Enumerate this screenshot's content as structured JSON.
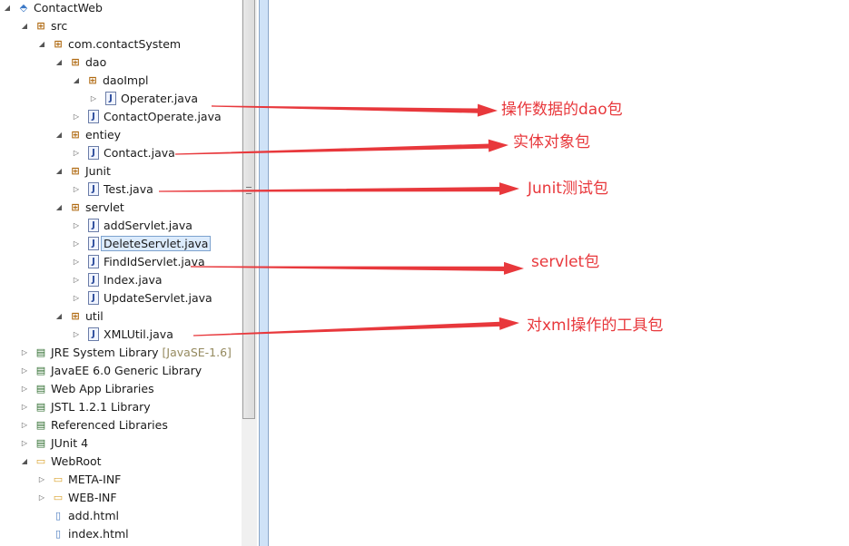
{
  "tree": [
    {
      "label": "ContactWeb",
      "level": 0,
      "twisty": "expanded",
      "icon": "project-icon"
    },
    {
      "label": "src",
      "level": 1,
      "twisty": "expanded",
      "icon": "source-folder-icon"
    },
    {
      "label": "com.contactSystem",
      "level": 2,
      "twisty": "expanded",
      "icon": "package-icon"
    },
    {
      "label": "dao",
      "level": 3,
      "twisty": "expanded",
      "icon": "package-icon"
    },
    {
      "label": "daoImpl",
      "level": 4,
      "twisty": "expanded",
      "icon": "package-icon"
    },
    {
      "label": "Operater.java",
      "level": 5,
      "twisty": "collapsed",
      "icon": "java-file-icon"
    },
    {
      "label": "ContactOperate.java",
      "level": 4,
      "twisty": "collapsed",
      "icon": "java-file-icon"
    },
    {
      "label": "entiey",
      "level": 3,
      "twisty": "expanded",
      "icon": "package-icon"
    },
    {
      "label": "Contact.java",
      "level": 4,
      "twisty": "collapsed",
      "icon": "java-file-icon"
    },
    {
      "label": "Junit",
      "level": 3,
      "twisty": "expanded",
      "icon": "package-icon"
    },
    {
      "label": "Test.java",
      "level": 4,
      "twisty": "collapsed",
      "icon": "java-file-icon"
    },
    {
      "label": "servlet",
      "level": 3,
      "twisty": "expanded",
      "icon": "package-icon"
    },
    {
      "label": "addServlet.java",
      "level": 4,
      "twisty": "collapsed",
      "icon": "java-file-icon"
    },
    {
      "label": "DeleteServlet.java",
      "level": 4,
      "twisty": "collapsed",
      "icon": "java-file-icon",
      "selected": true
    },
    {
      "label": "FindIdServlet.java",
      "level": 4,
      "twisty": "collapsed",
      "icon": "java-file-icon"
    },
    {
      "label": "Index.java",
      "level": 4,
      "twisty": "collapsed",
      "icon": "java-file-icon"
    },
    {
      "label": "UpdateServlet.java",
      "level": 4,
      "twisty": "collapsed",
      "icon": "java-file-icon"
    },
    {
      "label": "util",
      "level": 3,
      "twisty": "expanded",
      "icon": "package-icon"
    },
    {
      "label": "XMLUtil.java",
      "level": 4,
      "twisty": "collapsed",
      "icon": "java-file-icon"
    },
    {
      "label": "JRE System Library",
      "level": 1,
      "twisty": "collapsed",
      "icon": "library-icon",
      "decoration": "[JavaSE-1.6]"
    },
    {
      "label": "JavaEE 6.0 Generic Library",
      "level": 1,
      "twisty": "collapsed",
      "icon": "library-icon"
    },
    {
      "label": "Web App Libraries",
      "level": 1,
      "twisty": "collapsed",
      "icon": "library-icon"
    },
    {
      "label": "JSTL 1.2.1 Library",
      "level": 1,
      "twisty": "collapsed",
      "icon": "library-icon"
    },
    {
      "label": "Referenced Libraries",
      "level": 1,
      "twisty": "collapsed",
      "icon": "library-icon"
    },
    {
      "label": "JUnit 4",
      "level": 1,
      "twisty": "collapsed",
      "icon": "library-icon"
    },
    {
      "label": "WebRoot",
      "level": 1,
      "twisty": "expanded",
      "icon": "folder-icon"
    },
    {
      "label": "META-INF",
      "level": 2,
      "twisty": "collapsed",
      "icon": "folder-icon"
    },
    {
      "label": "WEB-INF",
      "level": 2,
      "twisty": "collapsed",
      "icon": "folder-icon"
    },
    {
      "label": "add.html",
      "level": 2,
      "twisty": "none",
      "icon": "html-file-icon"
    },
    {
      "label": "index.html",
      "level": 2,
      "twisty": "none",
      "icon": "html-file-icon"
    }
  ],
  "annotations": [
    {
      "text": "操作数据的dao包",
      "target": "Operater.java"
    },
    {
      "text": "实体对象包",
      "target": "Contact.java"
    },
    {
      "text": "Junit测试包",
      "target": "Test.java"
    },
    {
      "text": "servlet包",
      "target": "FindIdServlet.java"
    },
    {
      "text": "对xml操作的工具包",
      "target": "XMLUtil.java"
    }
  ],
  "colors": {
    "annotation": "#e8383c",
    "selection": "#dcebfc"
  }
}
